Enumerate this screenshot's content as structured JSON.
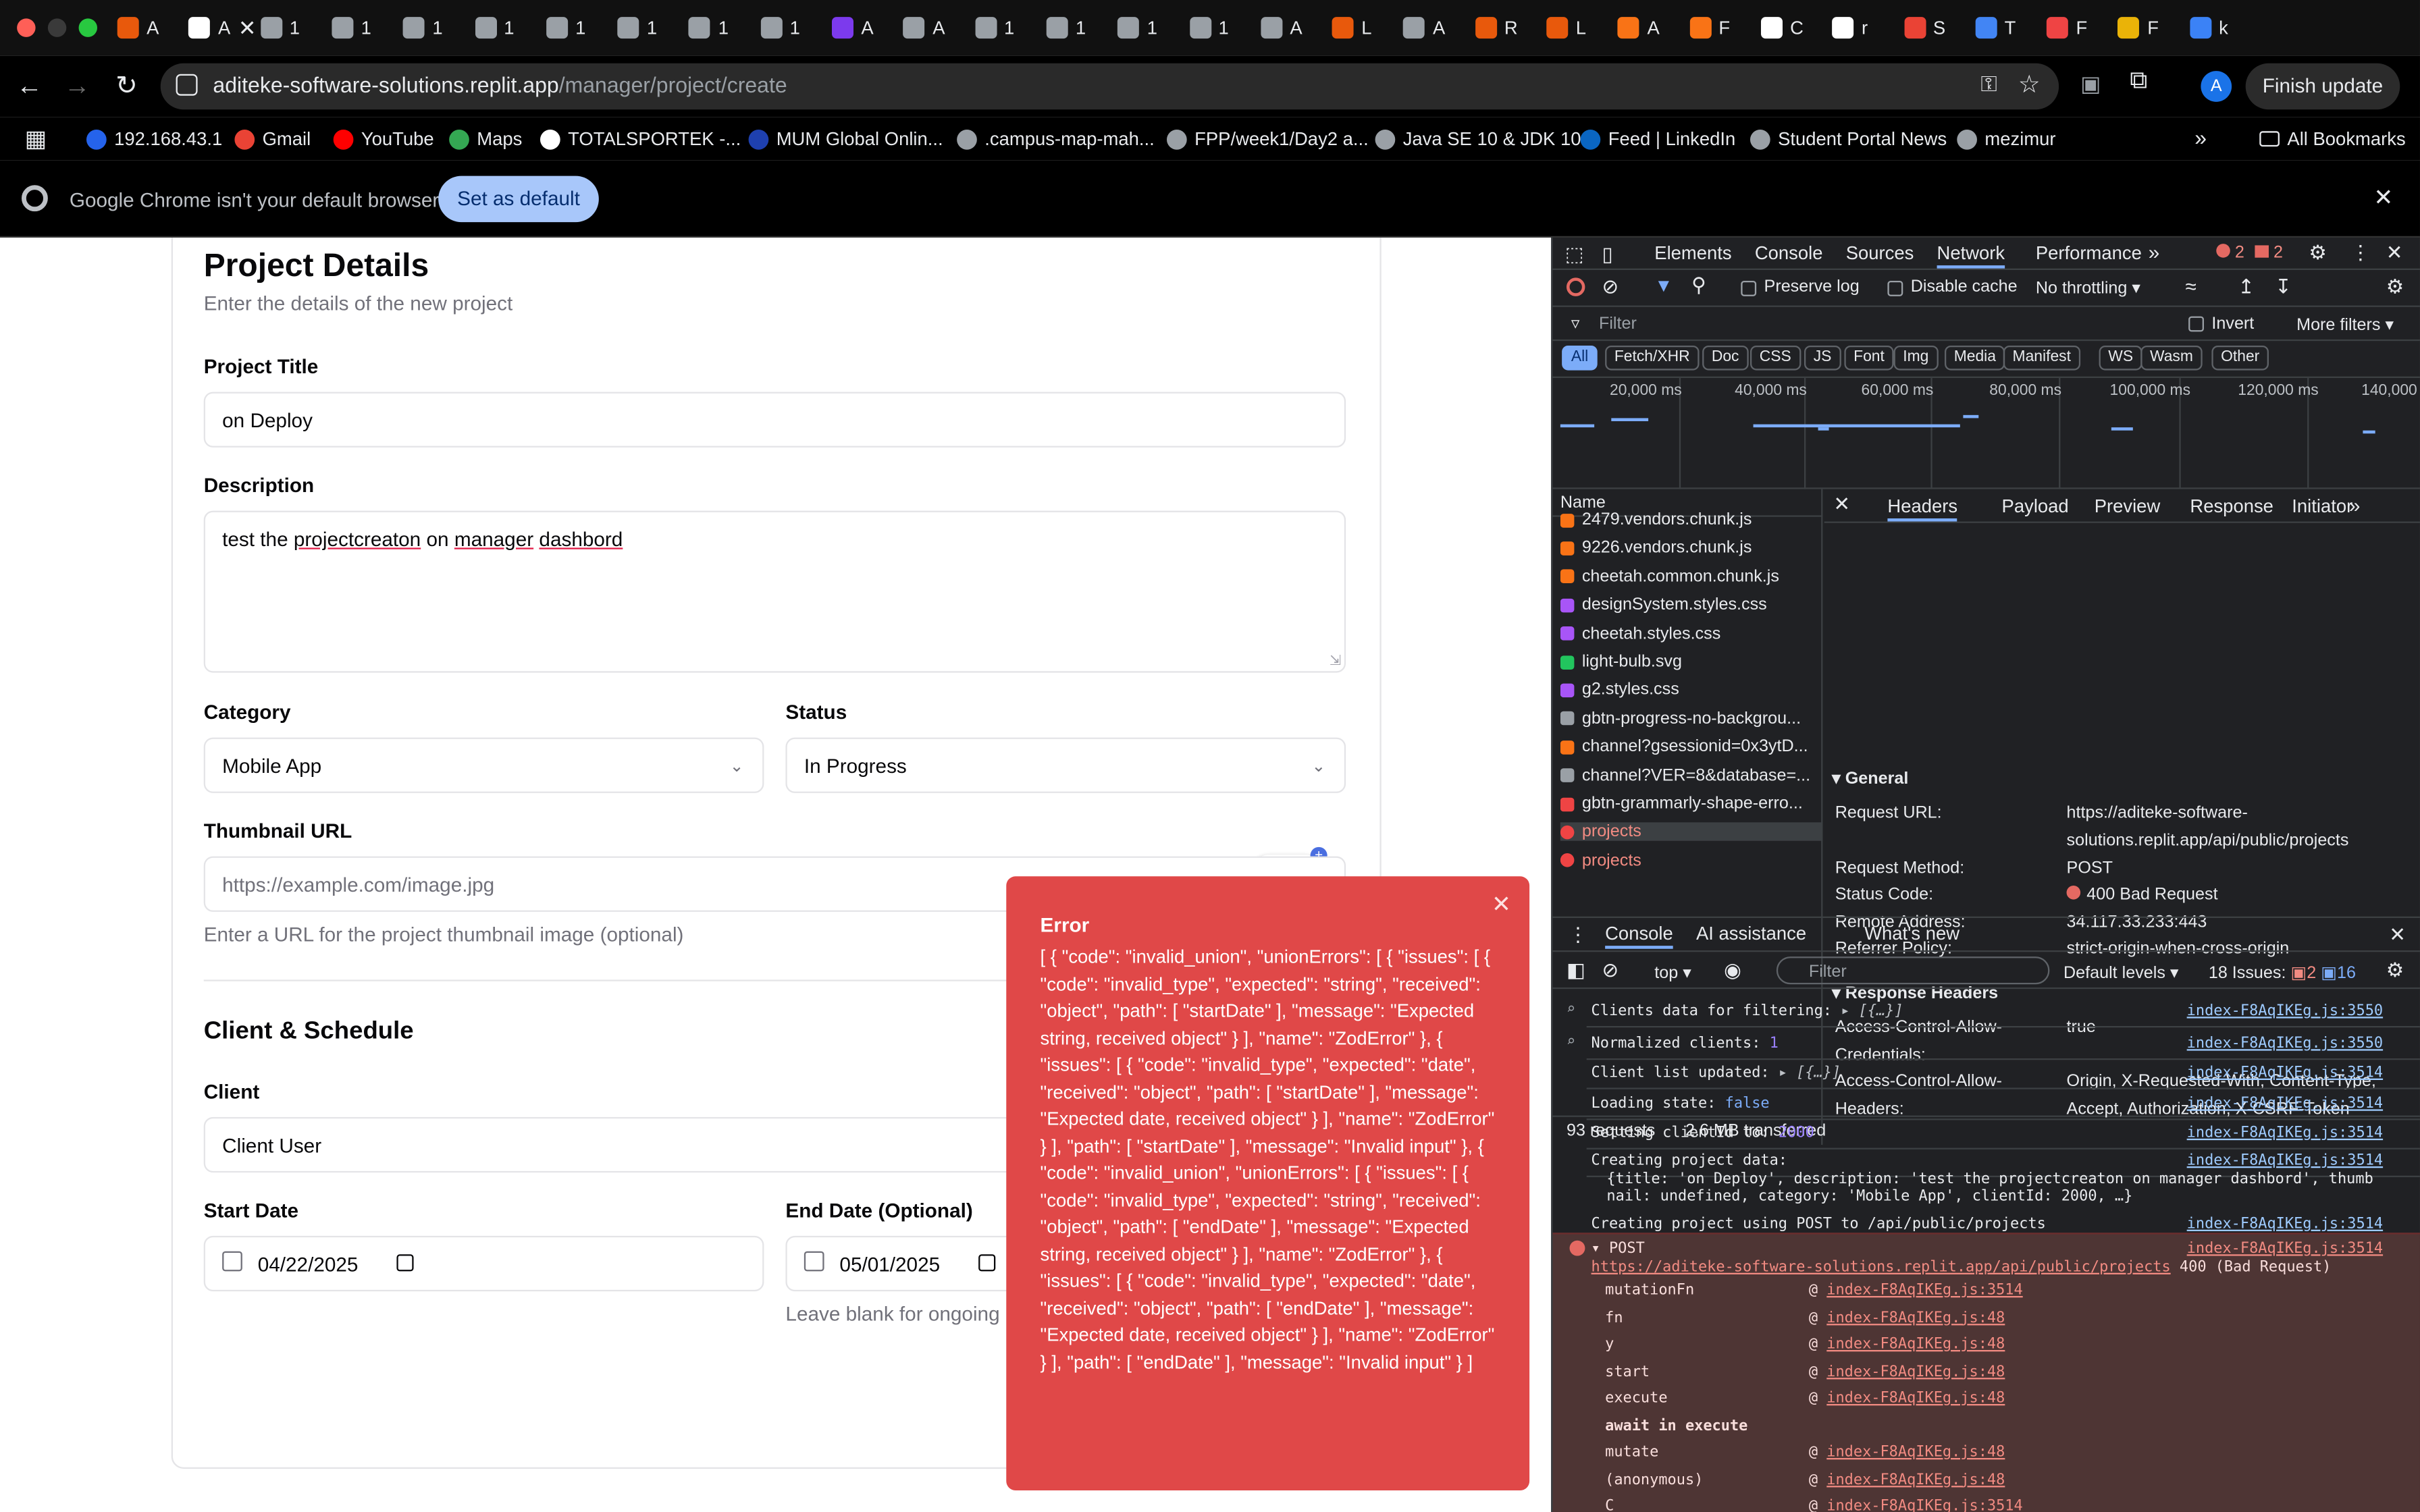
{
  "browser": {
    "tabs": [
      {
        "label": "A",
        "color": "#e8590c"
      },
      {
        "label": "A",
        "color": "#ffffff"
      },
      {
        "label": "1",
        "color": "#9aa0a6"
      },
      {
        "label": "1",
        "color": "#9aa0a6"
      },
      {
        "label": "1",
        "color": "#9aa0a6"
      },
      {
        "label": "1",
        "color": "#9aa0a6"
      },
      {
        "label": "1",
        "color": "#9aa0a6"
      },
      {
        "label": "1",
        "color": "#9aa0a6"
      },
      {
        "label": "1",
        "color": "#9aa0a6"
      },
      {
        "label": "1",
        "color": "#9aa0a6"
      },
      {
        "label": "A",
        "color": "#7c3aed"
      },
      {
        "label": "A",
        "color": "#9aa0a6"
      },
      {
        "label": "1",
        "color": "#9aa0a6"
      },
      {
        "label": "1",
        "color": "#9aa0a6"
      },
      {
        "label": "1",
        "color": "#9aa0a6"
      },
      {
        "label": "1",
        "color": "#9aa0a6"
      },
      {
        "label": "A",
        "color": "#9aa0a6"
      },
      {
        "label": "L",
        "color": "#e8590c"
      },
      {
        "label": "A",
        "color": "#9aa0a6"
      },
      {
        "label": "R",
        "color": "#e8590c"
      },
      {
        "label": "L",
        "color": "#e8590c"
      },
      {
        "label": "A",
        "color": "#f97316"
      },
      {
        "label": "F",
        "color": "#f97316"
      },
      {
        "label": "C",
        "color": "#ffffff"
      },
      {
        "label": "r",
        "color": "#ffffff"
      },
      {
        "label": "S",
        "color": "#ea4335"
      },
      {
        "label": "T",
        "color": "#4285f4"
      },
      {
        "label": "F",
        "color": "#ef4444"
      },
      {
        "label": "F",
        "color": "#eab308"
      },
      {
        "label": "k",
        "color": "#3b82f6"
      }
    ],
    "url_host": "aditeke-software-solutions.replit.app",
    "url_path": "/manager/project/create",
    "profile_initial": "A",
    "finish_update": "Finish update",
    "bookmarks": [
      {
        "label": "192.168.43.1",
        "color": "#2563eb"
      },
      {
        "label": "Gmail",
        "color": "#ea4335"
      },
      {
        "label": "YouTube",
        "color": "#ff0000"
      },
      {
        "label": "Maps",
        "color": "#34a853"
      },
      {
        "label": "TOTALSPORTEK -...",
        "color": "#ffffff"
      },
      {
        "label": "MUM Global Onlin...",
        "color": "#1e40af"
      },
      {
        "label": ".campus-map-mah...",
        "color": "#9aa0a6"
      },
      {
        "label": "FPP/week1/Day2 a...",
        "color": "#9aa0a6"
      },
      {
        "label": "Java SE 10 & JDK 10",
        "color": "#9aa0a6"
      },
      {
        "label": "Feed | LinkedIn",
        "color": "#0a66c2"
      },
      {
        "label": "Student Portal News",
        "color": "#9aa0a6"
      },
      {
        "label": "mezimur",
        "color": "#9aa0a6"
      }
    ],
    "all_bookmarks": "All Bookmarks",
    "infobar_text": "Google Chrome isn't your default browser",
    "set_default": "Set as default"
  },
  "form": {
    "title": "Project Details",
    "subtitle": "Enter the details of the new project",
    "project_title_label": "Project Title",
    "project_title_value": "on Deploy",
    "description_label": "Description",
    "description_words": [
      "test the",
      "projectcreaton",
      "on",
      "manager",
      "dashbord"
    ],
    "grammarly_count": "3",
    "category_label": "Category",
    "category_value": "Mobile App",
    "status_label": "Status",
    "status_value": "In Progress",
    "thumbnail_label": "Thumbnail URL",
    "thumbnail_placeholder": "https://example.com/image.jpg",
    "thumbnail_hint": "Enter a URL for the project thumbnail image (optional)",
    "section_title": "Client & Schedule",
    "client_label": "Client",
    "client_value": "Client User",
    "start_label": "Start Date",
    "start_value": "04/22/2025",
    "end_label": "End Date (Optional)",
    "end_value": "05/01/2025",
    "end_hint": "Leave blank for ongoing p"
  },
  "toast": {
    "title": "Error",
    "body": "[ { \"code\": \"invalid_union\", \"unionErrors\": [ { \"issues\": [ { \"code\": \"invalid_type\", \"expected\": \"string\", \"received\": \"object\", \"path\": [ \"startDate\" ], \"message\": \"Expected string, received object\" } ], \"name\": \"ZodError\" }, { \"issues\": [ { \"code\": \"invalid_type\", \"expected\": \"date\", \"received\": \"object\", \"path\": [ \"startDate\" ], \"message\": \"Expected date, received object\" } ], \"name\": \"ZodError\" } ], \"path\": [ \"startDate\" ], \"message\": \"Invalid input\" }, { \"code\": \"invalid_union\", \"unionErrors\": [ { \"issues\": [ { \"code\": \"invalid_type\", \"expected\": \"string\", \"received\": \"object\", \"path\": [ \"endDate\" ], \"message\": \"Expected string, received object\" } ], \"name\": \"ZodError\" }, { \"issues\": [ { \"code\": \"invalid_type\", \"expected\": \"date\", \"received\": \"object\", \"path\": [ \"endDate\" ], \"message\": \"Expected date, received object\" } ], \"name\": \"ZodError\" } ], \"path\": [ \"endDate\" ], \"message\": \"Invalid input\" } ]"
  },
  "devtools": {
    "tabs": [
      "Elements",
      "Console",
      "Sources",
      "Network",
      "Performance"
    ],
    "active_tab": "Network",
    "error_count": "2",
    "warning_count": "2",
    "preserve_log": "Preserve log",
    "disable_cache": "Disable cache",
    "throttling": "No throttling",
    "filter_placeholder": "Filter",
    "invert": "Invert",
    "more_filters": "More filters",
    "type_filters": [
      "All",
      "Fetch/XHR",
      "Doc",
      "CSS",
      "JS",
      "Font",
      "Img",
      "Media",
      "Manifest",
      "WS",
      "Wasm",
      "Other"
    ],
    "timeline_labels": [
      "20,000 ms",
      "40,000 ms",
      "60,000 ms",
      "80,000 ms",
      "100,000 ms",
      "120,000 ms",
      "140,000"
    ],
    "name_header": "Name",
    "requests": [
      {
        "name": "2479.vendors.chunk.js",
        "color": "#f97316",
        "error": false
      },
      {
        "name": "9226.vendors.chunk.js",
        "color": "#f97316",
        "error": false
      },
      {
        "name": "cheetah.common.chunk.js",
        "color": "#f97316",
        "error": false
      },
      {
        "name": "designSystem.styles.css",
        "color": "#a855f7",
        "error": false
      },
      {
        "name": "cheetah.styles.css",
        "color": "#a855f7",
        "error": false
      },
      {
        "name": "light-bulb.svg",
        "color": "#22c55e",
        "error": false
      },
      {
        "name": "g2.styles.css",
        "color": "#a855f7",
        "error": false
      },
      {
        "name": "gbtn-progress-no-backgrou...",
        "color": "#9aa0a6",
        "error": false
      },
      {
        "name": "channel?gsessionid=0x3ytD...",
        "color": "#f97316",
        "error": false
      },
      {
        "name": "channel?VER=8&database=...",
        "color": "#9aa0a6",
        "error": false
      },
      {
        "name": "gbtn-grammarly-shape-erro...",
        "color": "#ef4444",
        "error": false
      },
      {
        "name": "projects",
        "color": "#ef4444",
        "error": true
      },
      {
        "name": "projects",
        "color": "#ef4444",
        "error": true
      }
    ],
    "requests_count": "93 requests",
    "transferred": "2.6 MB transferred",
    "detail_tabs": [
      "Headers",
      "Payload",
      "Preview",
      "Response",
      "Initiator"
    ],
    "general_title": "General",
    "general": [
      {
        "key": "Request URL:",
        "value": "https://aditeke-software-solutions.replit.app/api/public/projects"
      },
      {
        "key": "Request Method:",
        "value": "POST"
      },
      {
        "key": "Status Code:",
        "value": "400 Bad Request"
      },
      {
        "key": "Remote Address:",
        "value": "34.117.33.233:443"
      },
      {
        "key": "Referrer Policy:",
        "value": "strict-origin-when-cross-origin"
      }
    ],
    "response_headers_title": "Response Headers",
    "response_headers": [
      {
        "key": "Access-Control-Allow-Credentials:",
        "value": "true"
      },
      {
        "key": "Access-Control-Allow-Headers:",
        "value": "Origin, X-Requested-With, Content-Type, Accept, Authorization, X-CSRF-Token"
      }
    ],
    "drawer_tabs": [
      "Console",
      "AI assistance",
      "What's new"
    ],
    "context": "top",
    "console_filter": "Filter",
    "default_levels": "Default levels",
    "issues_label": "18 Issues:",
    "issues_errors": "2",
    "issues_info": "16",
    "console_lines": [
      {
        "text": "Clients data for filtering:",
        "extra": "▸ [{…}]",
        "src": "index-F8AqIKEg.js:3550"
      },
      {
        "text": "Normalized clients:",
        "extra": "1",
        "src": "index-F8AqIKEg.js:3550"
      },
      {
        "text": "Client list updated:",
        "extra": "▸ [{…}]",
        "src": "index-F8AqIKEg.js:3514"
      },
      {
        "text": "Loading state:",
        "extra": "false",
        "src": "index-F8AqIKEg.js:3514"
      },
      {
        "text": "Setting clientId to:",
        "extra": "2000",
        "src": "index-F8AqIKEg.js:3514"
      },
      {
        "text": "Creating project data:",
        "extra": "",
        "src": "index-F8AqIKEg.js:3514"
      },
      {
        "text": "Creating project using POST to /api/public/projects",
        "extra": "",
        "src": "index-F8AqIKEg.js:3514"
      }
    ],
    "project_obj_line1": "{title: 'on Deploy', description: 'test the projectcreaton on manager dashbord', thumb",
    "project_obj_line2": "nail: undefined, category: 'Mobile App', clientId: 2000, …}",
    "error_head": "POST",
    "error_url": "https://aditeke-software-solutions.replit.app/api/public/projects",
    "error_status": "400 (Bad Request)",
    "error_src": "index-F8AqIKEg.js:3514",
    "stack": [
      {
        "fn": "mutationFn",
        "at": "@",
        "src": "index-F8AqIKEg.js:3514"
      },
      {
        "fn": "fn",
        "at": "@",
        "src": "index-F8AqIKEg.js:48"
      },
      {
        "fn": "y",
        "at": "@",
        "src": "index-F8AqIKEg.js:48"
      },
      {
        "fn": "start",
        "at": "@",
        "src": "index-F8AqIKEg.js:48"
      },
      {
        "fn": "execute",
        "at": "@",
        "src": "index-F8AqIKEg.js:48"
      },
      {
        "fn": "await in execute",
        "at": "",
        "src": ""
      },
      {
        "fn": "mutate",
        "at": "@",
        "src": "index-F8AqIKEg.js:48"
      },
      {
        "fn": "(anonymous)",
        "at": "@",
        "src": "index-F8AqIKEg.js:48"
      },
      {
        "fn": "C",
        "at": "@",
        "src": "index-F8AqIKEg.js:3514"
      }
    ]
  }
}
